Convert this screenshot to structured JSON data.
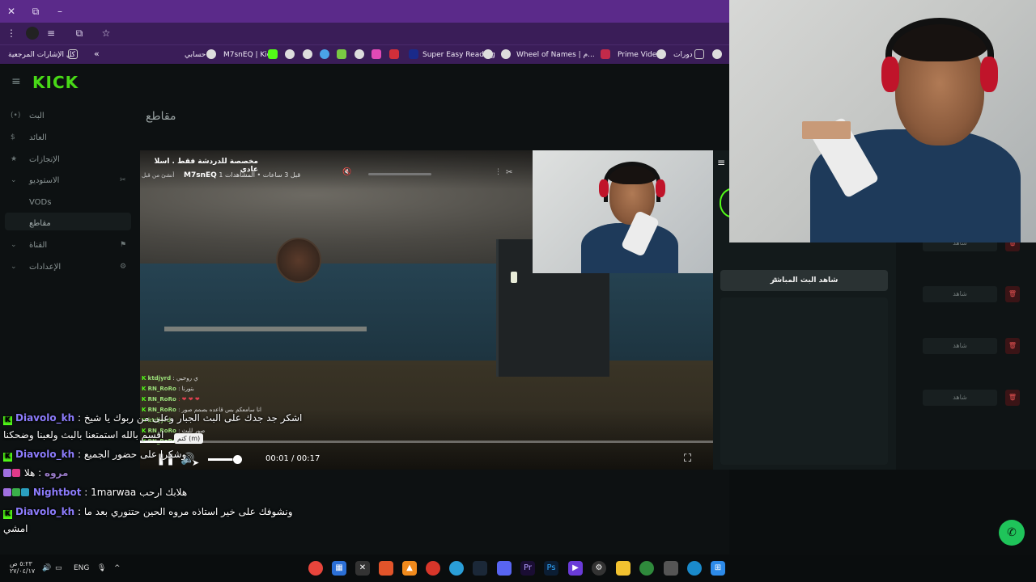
{
  "browser": {
    "titlebar": {
      "close": "✕",
      "restore": "⧉",
      "minimize": "–"
    },
    "toolbar": {
      "menu_icon": "⋮",
      "profile_icon": "profile",
      "filter_icon": "≡",
      "share_icon": "⧉",
      "star_icon": "☆"
    },
    "bookmarks": [
      {
        "label": "كل الإشارات المرجعية",
        "icon": "folder-icon"
      },
      {
        "label": "حسابي",
        "icon": "globe-icon"
      },
      {
        "label": "M7snEQ | Kick",
        "icon": "kick-icon"
      },
      {
        "label": "Super Easy Reading",
        "icon": "globe-icon"
      },
      {
        "label": "Wheel of Names | م...",
        "icon": "globe-icon"
      },
      {
        "label": "Prime Video",
        "icon": "prime-icon"
      },
      {
        "label": "دورات",
        "icon": "folder-icon"
      }
    ],
    "bookmarks_chevron": "«"
  },
  "kick": {
    "logo": "KICK",
    "sidebar": [
      {
        "label": "البث",
        "icon": "(•)"
      },
      {
        "label": "العائد",
        "icon": "$"
      },
      {
        "label": "الإنجازات",
        "icon": "★"
      },
      {
        "label": "الاستوديو",
        "icon": "⌄"
      },
      {
        "label": "VODs",
        "icon": ""
      },
      {
        "label": "مقاطع",
        "icon": ""
      },
      {
        "label": "القناة",
        "icon": "⌄"
      },
      {
        "label": "الإعدادات",
        "icon": "⌄"
      }
    ],
    "page_heading": "مقاطع",
    "watch_live": "شاهد البث المباشر",
    "row_watch_label": "شاهد",
    "row_delete_icon": "🗑"
  },
  "video": {
    "title": "مخصصة للدردشة فقط . اسلا عادي",
    "channel": "M7snEQ",
    "meta": "قبل 3 ساعات • المشاهدات 1",
    "meta2": "أنشئ من قبل",
    "mute_tooltip": "كتم (m)",
    "time": "00:01 / 00:17",
    "progress": 0.06,
    "volume": 0.8,
    "mini_chat": [
      {
        "user": "ktdjyrd",
        "text": ": ي روحيي"
      },
      {
        "user": "RN_RoRo",
        "text": ": بتورنا"
      },
      {
        "user": "RN_RoRo",
        "text": ": ❤ ❤ ❤"
      },
      {
        "user": "RN_RoRo",
        "text": ": انا سامعكم بس قاعده بصمم صور"
      },
      {
        "user": "ktdjyrd",
        "text": ""
      },
      {
        "user": "RN_RoRo",
        "text": ": صور للبث"
      },
      {
        "user": "RN_RoRo",
        "text": ""
      }
    ]
  },
  "chat": [
    {
      "user": "Diavolo_kh",
      "text": ": اشكر جد جدك على البث الجبار وعلى من ربوك يا شيخ",
      "color": "#8c7cfc"
    },
    {
      "user": "",
      "text": "اقسم بالله استمتعنا بالبث ولعبنا وضحكنا",
      "color": "#8c7cfc"
    },
    {
      "user": "Diavolo_kh",
      "text": ": وشكرا على حضور الجميع",
      "color": "#8c7cfc"
    },
    {
      "user": "مروه",
      "text": ": هلا",
      "color": "#9a7cc9"
    },
    {
      "user": "Nightbot",
      "text": ": 1marwaa هلابك ارحب",
      "color": "#8c7cfc"
    },
    {
      "user": "Diavolo_kh",
      "text": ": ونشوفك على خير استاذه مروه الحين حتنوري بعد ما",
      "color": "#8c7cfc"
    },
    {
      "user": "",
      "text": "امشي",
      "color": "#8c7cfc"
    }
  ],
  "taskbar": {
    "time": "٥:٢٣ ص",
    "date": "٢٧/٠٤/١٧",
    "lang": "ENG",
    "apps": [
      "chrome",
      "grid",
      "excel",
      "brave",
      "vlc",
      "record",
      "telegram",
      "steam",
      "discord",
      "premiere",
      "photoshop",
      "stream",
      "settings",
      "explorer",
      "chrome2",
      "store",
      "edge",
      "windows"
    ]
  },
  "colors": {
    "kick_green": "#53fc18",
    "purple_chrome": "#3a1d58",
    "chat_user": "#8c7cfc"
  }
}
